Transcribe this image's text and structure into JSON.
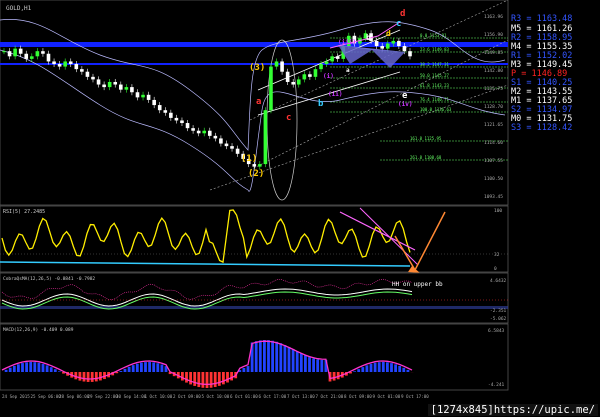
{
  "window": {
    "symbol_title": "GOLD,H1"
  },
  "indicators": {
    "rsi_label": "RSI(5) 27.2485",
    "qqe_label": "CobraQsMA(12,26,5) -0.8841 -0.7982",
    "qqe_note": "HH on upper bb",
    "macd_label": "MACD(12,26,9) -0.409 0.089"
  },
  "pivot_levels": [
    {
      "name": "R3",
      "text": "R3 = 1163.48",
      "color": "#3355ff"
    },
    {
      "name": "M5",
      "text": "M5 = 1161.26",
      "color": "#ffffff"
    },
    {
      "name": "R2",
      "text": "R2 = 1158.95",
      "color": "#3355ff"
    },
    {
      "name": "M4",
      "text": "M4 = 1155.35",
      "color": "#ffffff"
    },
    {
      "name": "R1",
      "text": "R1 = 1152.02",
      "color": "#3355ff"
    },
    {
      "name": "M3",
      "text": "M3 = 1149.45",
      "color": "#ffffff"
    },
    {
      "name": "P",
      "text": "P = 1146.89",
      "color": "#ff2222"
    },
    {
      "name": "S1",
      "text": "S1 = 1140.25",
      "color": "#3355ff"
    },
    {
      "name": "M2",
      "text": "M2 = 1143.55",
      "color": "#ffffff"
    },
    {
      "name": "M1",
      "text": "M1 = 1137.65",
      "color": "#ffffff"
    },
    {
      "name": "S2",
      "text": "S2 = 1134.97",
      "color": "#3355ff"
    },
    {
      "name": "M0",
      "text": "M0 = 1131.75",
      "color": "#ffffff"
    },
    {
      "name": "S3",
      "text": "S3 = 1128.42",
      "color": "#3355ff"
    }
  ],
  "wave_labels": [
    {
      "t": "(3)",
      "c": "#ffcc00"
    },
    {
      "t": "a",
      "c": "#ff3333"
    },
    {
      "t": "b",
      "c": "#33ccff"
    },
    {
      "t": "c",
      "c": "#ff3333"
    },
    {
      "t": "(1)",
      "c": "#ffcc00"
    },
    {
      "t": "(2)",
      "c": "#ffcc00"
    },
    {
      "t": "(i)",
      "c": "#cc33ff"
    },
    {
      "t": "(ii)",
      "c": "#cc33ff"
    },
    {
      "t": "(iii)",
      "c": "#cc33ff"
    },
    {
      "t": "(iv)",
      "c": "#cc33ff"
    },
    {
      "t": "d",
      "c": "#ff3333"
    },
    {
      "t": "c",
      "c": "#33ccff"
    },
    {
      "t": "e",
      "c": "#ffffff"
    },
    {
      "t": "b",
      "c": "#ffffff"
    },
    {
      "t": "d",
      "c": "#ffcc00"
    },
    {
      "t": "a",
      "c": "#ffffff"
    }
  ],
  "fib_labels": [
    "0.0 1153.91",
    "23.6 1149.83",
    "38.2 1147.31",
    "50.0 1145.27",
    "61.8 1143.23",
    "76.4 1140.71",
    "100.0 1136.63",
    "161.8 1125.95",
    "261.8 1108.68"
  ],
  "watermark": "[1274x845]https://upic.me/",
  "chart_data": {
    "type": "line",
    "title": "GOLD,H1",
    "price_axis_ticks": [
      "1163.96",
      "1156.90",
      "1149.85",
      "1142.80",
      "1135.75",
      "1128.70",
      "1121.65",
      "1114.60",
      "1107.55",
      "1100.50",
      "1093.45"
    ],
    "rsi_axis_ticks": [
      "100",
      "32",
      "0"
    ],
    "qqe_axis_ticks": [
      "4.6432",
      "-2.351",
      "-5.062"
    ],
    "macd_axis_ticks": [
      "6.5843",
      "-4.241"
    ],
    "x_ticks": [
      "24 Sep 2015",
      "25 Sep 06:00",
      "28 Sep 06:00",
      "29 Sep 22:00",
      "30 Sep 14:00",
      "1 Oct 10:00",
      "2 Oct 09:00",
      "5 Oct 10:00",
      "6 Oct 01:00",
      "6 Oct 17:00",
      "7 Oct 13:00",
      "7 Oct 21:00",
      "8 Oct 09:00",
      "9 Oct 01:00",
      "9 Oct 17:00"
    ],
    "close_series": [
      1148,
      1146,
      1149,
      1147,
      1145,
      1146,
      1148,
      1147,
      1144,
      1143,
      1142,
      1144,
      1143,
      1141,
      1140,
      1138,
      1137,
      1135,
      1134,
      1136,
      1135,
      1133,
      1134,
      1132,
      1130,
      1131,
      1129,
      1127,
      1125,
      1124,
      1122,
      1121,
      1120,
      1118,
      1117,
      1116,
      1117,
      1115,
      1114,
      1112,
      1111,
      1110,
      1108,
      1106,
      1104,
      1103,
      1104,
      1125,
      1142,
      1144,
      1140,
      1136,
      1135,
      1137,
      1139,
      1138,
      1141,
      1143,
      1144,
      1146,
      1145,
      1150,
      1154,
      1151,
      1153,
      1155,
      1152,
      1150,
      1149,
      1151,
      1152,
      1150,
      1148,
      1146
    ],
    "ylim": [
      1090,
      1166
    ]
  }
}
